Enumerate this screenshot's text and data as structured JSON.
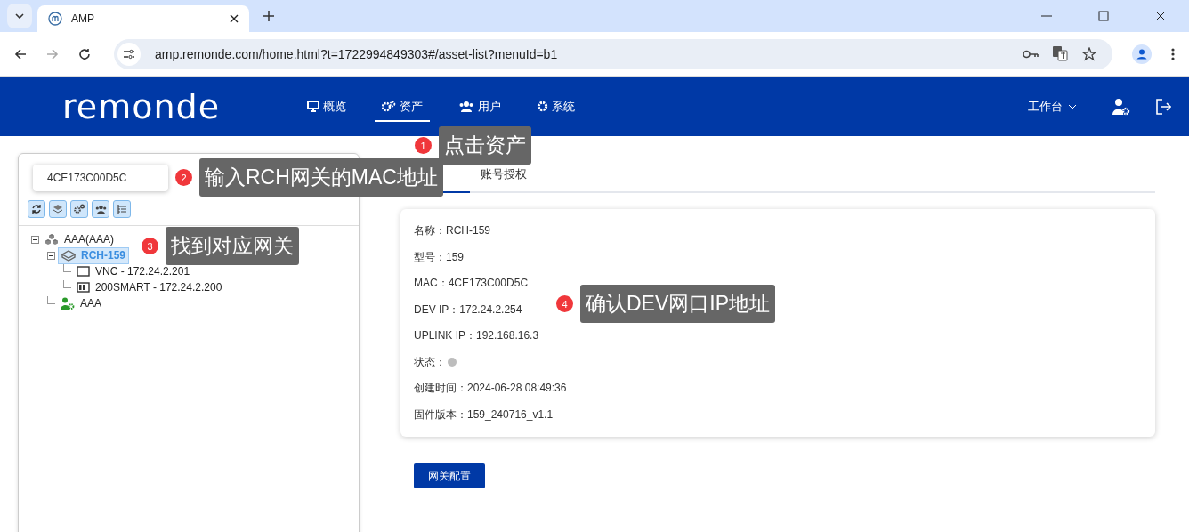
{
  "browser": {
    "tab_title": "AMP",
    "url": "amp.remonde.com/home.html?t=1722994849303#/asset-list?menuId=b1"
  },
  "header": {
    "logo": "remonde",
    "nav": [
      {
        "label": "概览",
        "selected": false
      },
      {
        "label": "资产",
        "selected": true
      },
      {
        "label": "用户",
        "selected": false
      },
      {
        "label": "系统",
        "selected": false
      }
    ],
    "workspace": "工作台"
  },
  "search": {
    "value": "4CE173C00D5C"
  },
  "tree": [
    {
      "label": "AAA(AAA)",
      "kind": "group",
      "expanded": true,
      "selected": false,
      "children": [
        {
          "label": "RCH-159",
          "kind": "gateway",
          "expanded": true,
          "selected": true,
          "children": [
            {
              "label": "VNC - 172.24.2.201",
              "kind": "screen",
              "selected": false
            },
            {
              "label": "200SMART - 172.24.2.200",
              "kind": "plc",
              "selected": false
            }
          ]
        },
        {
          "label": "AAA",
          "kind": "user",
          "selected": false
        }
      ]
    }
  ],
  "tabs": [
    {
      "label": "账号授权",
      "selected": false
    }
  ],
  "details": [
    {
      "label": "名称：",
      "value": "RCH-159"
    },
    {
      "label": "型号：",
      "value": "159"
    },
    {
      "label": "MAC：",
      "value": "4CE173C00D5C"
    },
    {
      "label": "DEV IP：",
      "value": "172.24.2.254"
    },
    {
      "label": "UPLINK IP：",
      "value": "192.168.16.3"
    },
    {
      "label": "状态：",
      "kind": "status",
      "online": false
    },
    {
      "label": "创建时间：",
      "value": "2024-06-28 08:49:36"
    },
    {
      "label": "固件版本：",
      "value": "159_240716_v1.1"
    }
  ],
  "config_button": "网关配置",
  "annotations": [
    {
      "number": "1",
      "text": "点击资产"
    },
    {
      "number": "2",
      "text": "输入RCH网关的MAC地址"
    },
    {
      "number": "3",
      "text": "找到对应网关"
    },
    {
      "number": "4",
      "text": "确认DEV网口IP地址"
    }
  ]
}
